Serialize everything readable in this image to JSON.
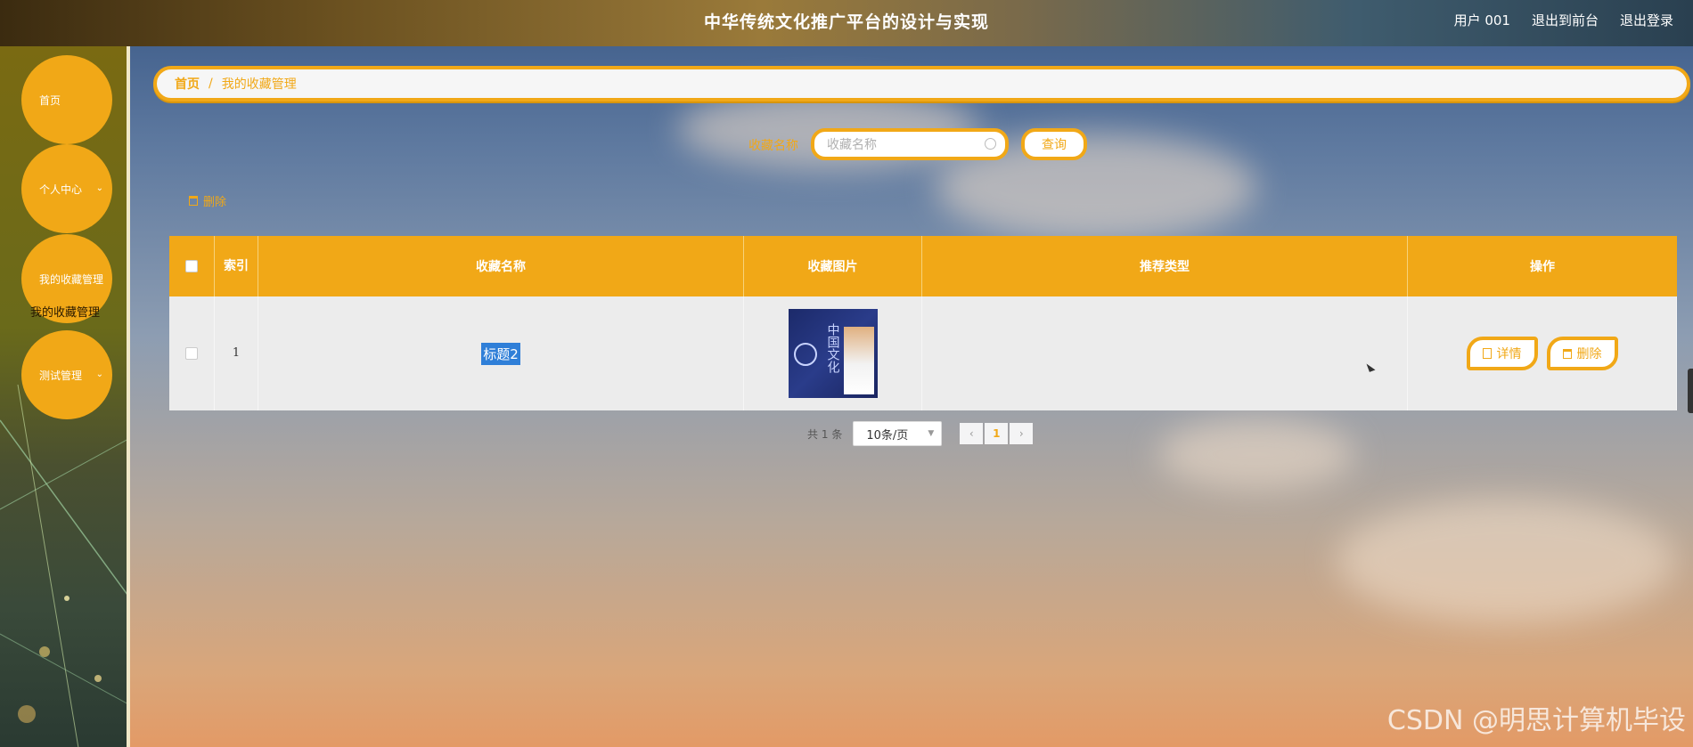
{
  "header": {
    "title": "中华传统文化推广平台的设计与实现",
    "user": "用户 001",
    "to_front": "退出到前台",
    "logout": "退出登录"
  },
  "sidebar": {
    "items": [
      {
        "label": "首页"
      },
      {
        "label": "个人中心"
      },
      {
        "label": "我的收藏管理"
      },
      {
        "label": "测试管理"
      }
    ],
    "sub_label": "我的收藏管理"
  },
  "breadcrumb": {
    "home": "首页",
    "separator": "/",
    "current": "我的收藏管理"
  },
  "search": {
    "label": "收藏名称",
    "placeholder": "收藏名称",
    "button": "查询"
  },
  "toolbar": {
    "delete_label": "删除"
  },
  "table": {
    "headers": [
      "索引",
      "收藏名称",
      "收藏图片",
      "推荐类型",
      "操作"
    ],
    "rows": [
      {
        "index": "1",
        "name": "标题2",
        "image_text": "中国文化",
        "type": "",
        "detail": "详情",
        "delete": "删除"
      }
    ]
  },
  "pagination": {
    "total_prefix": "共",
    "total": "1",
    "total_suffix": "条",
    "page_size": "10条/页",
    "current_page": "1",
    "prev": "‹",
    "next": "›"
  },
  "watermark": "CSDN @明思计算机毕设",
  "colors": {
    "accent": "#f1a817",
    "selection": "#2f7fd8"
  }
}
